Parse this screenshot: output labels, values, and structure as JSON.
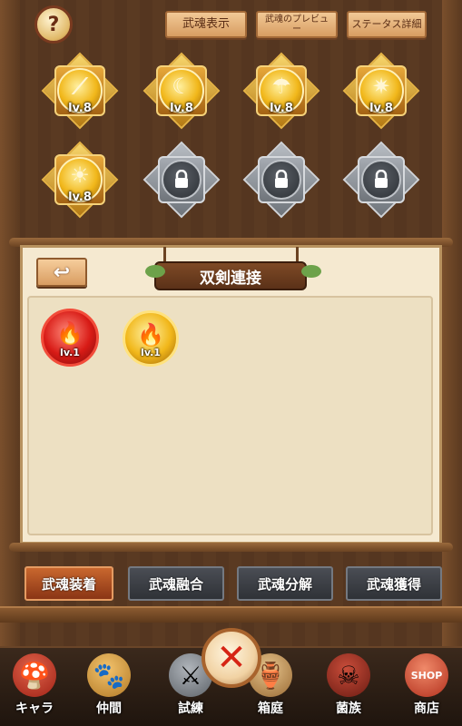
{
  "header": {
    "tabs": [
      {
        "label": "武魂表示"
      },
      {
        "label": "武魂のプレビュー"
      },
      {
        "label": "ステータス詳細"
      }
    ],
    "help_icon": "question-book-icon"
  },
  "souls_grid": [
    {
      "level": "lv.8",
      "icon": "sword-slash-icon"
    },
    {
      "level": "lv.8",
      "icon": "claw-icon"
    },
    {
      "level": "lv.8",
      "icon": "mushroom-icon"
    },
    {
      "level": "lv.8",
      "icon": "burst-icon"
    },
    {
      "level": "lv.8",
      "icon": "sun-icon"
    },
    {
      "locked": true,
      "icon": "lock-icon"
    },
    {
      "locked": true,
      "icon": "lock-icon"
    },
    {
      "locked": true,
      "icon": "lock-icon"
    }
  ],
  "panel": {
    "title": "双剣連接",
    "equipped_souls": [
      {
        "level": "lv.1",
        "color": "red"
      },
      {
        "level": "lv.1",
        "color": "gold"
      }
    ]
  },
  "bottom_tabs": [
    {
      "label": "武魂装着",
      "active": true
    },
    {
      "label": "武魂融合",
      "active": false
    },
    {
      "label": "武魂分解",
      "active": false
    },
    {
      "label": "武魂獲得",
      "active": false
    }
  ],
  "nav": [
    {
      "label": "キャラ",
      "icon": "mushroom-character-icon"
    },
    {
      "label": "仲間",
      "icon": "paw-icon"
    },
    {
      "label": "試練",
      "icon": "crossed-swords-icon"
    },
    {
      "label": "箱庭",
      "icon": "garden-icon"
    },
    {
      "label": "菌族",
      "icon": "clan-skull-icon"
    },
    {
      "label": "商店",
      "icon": "shop-icon",
      "badge": "SHOP"
    }
  ],
  "close_icon": "close-x-icon"
}
